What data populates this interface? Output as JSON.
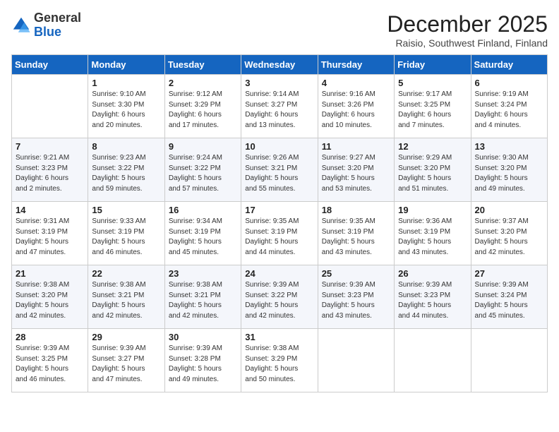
{
  "header": {
    "logo_line1": "General",
    "logo_line2": "Blue",
    "title": "December 2025",
    "subtitle": "Raisio, Southwest Finland, Finland"
  },
  "weekdays": [
    "Sunday",
    "Monday",
    "Tuesday",
    "Wednesday",
    "Thursday",
    "Friday",
    "Saturday"
  ],
  "weeks": [
    [
      {
        "day": "",
        "info": ""
      },
      {
        "day": "1",
        "info": "Sunrise: 9:10 AM\nSunset: 3:30 PM\nDaylight: 6 hours\nand 20 minutes."
      },
      {
        "day": "2",
        "info": "Sunrise: 9:12 AM\nSunset: 3:29 PM\nDaylight: 6 hours\nand 17 minutes."
      },
      {
        "day": "3",
        "info": "Sunrise: 9:14 AM\nSunset: 3:27 PM\nDaylight: 6 hours\nand 13 minutes."
      },
      {
        "day": "4",
        "info": "Sunrise: 9:16 AM\nSunset: 3:26 PM\nDaylight: 6 hours\nand 10 minutes."
      },
      {
        "day": "5",
        "info": "Sunrise: 9:17 AM\nSunset: 3:25 PM\nDaylight: 6 hours\nand 7 minutes."
      },
      {
        "day": "6",
        "info": "Sunrise: 9:19 AM\nSunset: 3:24 PM\nDaylight: 6 hours\nand 4 minutes."
      }
    ],
    [
      {
        "day": "7",
        "info": "Sunrise: 9:21 AM\nSunset: 3:23 PM\nDaylight: 6 hours\nand 2 minutes."
      },
      {
        "day": "8",
        "info": "Sunrise: 9:23 AM\nSunset: 3:22 PM\nDaylight: 5 hours\nand 59 minutes."
      },
      {
        "day": "9",
        "info": "Sunrise: 9:24 AM\nSunset: 3:22 PM\nDaylight: 5 hours\nand 57 minutes."
      },
      {
        "day": "10",
        "info": "Sunrise: 9:26 AM\nSunset: 3:21 PM\nDaylight: 5 hours\nand 55 minutes."
      },
      {
        "day": "11",
        "info": "Sunrise: 9:27 AM\nSunset: 3:20 PM\nDaylight: 5 hours\nand 53 minutes."
      },
      {
        "day": "12",
        "info": "Sunrise: 9:29 AM\nSunset: 3:20 PM\nDaylight: 5 hours\nand 51 minutes."
      },
      {
        "day": "13",
        "info": "Sunrise: 9:30 AM\nSunset: 3:20 PM\nDaylight: 5 hours\nand 49 minutes."
      }
    ],
    [
      {
        "day": "14",
        "info": "Sunrise: 9:31 AM\nSunset: 3:19 PM\nDaylight: 5 hours\nand 47 minutes."
      },
      {
        "day": "15",
        "info": "Sunrise: 9:33 AM\nSunset: 3:19 PM\nDaylight: 5 hours\nand 46 minutes."
      },
      {
        "day": "16",
        "info": "Sunrise: 9:34 AM\nSunset: 3:19 PM\nDaylight: 5 hours\nand 45 minutes."
      },
      {
        "day": "17",
        "info": "Sunrise: 9:35 AM\nSunset: 3:19 PM\nDaylight: 5 hours\nand 44 minutes."
      },
      {
        "day": "18",
        "info": "Sunrise: 9:35 AM\nSunset: 3:19 PM\nDaylight: 5 hours\nand 43 minutes."
      },
      {
        "day": "19",
        "info": "Sunrise: 9:36 AM\nSunset: 3:19 PM\nDaylight: 5 hours\nand 43 minutes."
      },
      {
        "day": "20",
        "info": "Sunrise: 9:37 AM\nSunset: 3:20 PM\nDaylight: 5 hours\nand 42 minutes."
      }
    ],
    [
      {
        "day": "21",
        "info": "Sunrise: 9:38 AM\nSunset: 3:20 PM\nDaylight: 5 hours\nand 42 minutes."
      },
      {
        "day": "22",
        "info": "Sunrise: 9:38 AM\nSunset: 3:21 PM\nDaylight: 5 hours\nand 42 minutes."
      },
      {
        "day": "23",
        "info": "Sunrise: 9:38 AM\nSunset: 3:21 PM\nDaylight: 5 hours\nand 42 minutes."
      },
      {
        "day": "24",
        "info": "Sunrise: 9:39 AM\nSunset: 3:22 PM\nDaylight: 5 hours\nand 42 minutes."
      },
      {
        "day": "25",
        "info": "Sunrise: 9:39 AM\nSunset: 3:23 PM\nDaylight: 5 hours\nand 43 minutes."
      },
      {
        "day": "26",
        "info": "Sunrise: 9:39 AM\nSunset: 3:23 PM\nDaylight: 5 hours\nand 44 minutes."
      },
      {
        "day": "27",
        "info": "Sunrise: 9:39 AM\nSunset: 3:24 PM\nDaylight: 5 hours\nand 45 minutes."
      }
    ],
    [
      {
        "day": "28",
        "info": "Sunrise: 9:39 AM\nSunset: 3:25 PM\nDaylight: 5 hours\nand 46 minutes."
      },
      {
        "day": "29",
        "info": "Sunrise: 9:39 AM\nSunset: 3:27 PM\nDaylight: 5 hours\nand 47 minutes."
      },
      {
        "day": "30",
        "info": "Sunrise: 9:39 AM\nSunset: 3:28 PM\nDaylight: 5 hours\nand 49 minutes."
      },
      {
        "day": "31",
        "info": "Sunrise: 9:38 AM\nSunset: 3:29 PM\nDaylight: 5 hours\nand 50 minutes."
      },
      {
        "day": "",
        "info": ""
      },
      {
        "day": "",
        "info": ""
      },
      {
        "day": "",
        "info": ""
      }
    ]
  ]
}
